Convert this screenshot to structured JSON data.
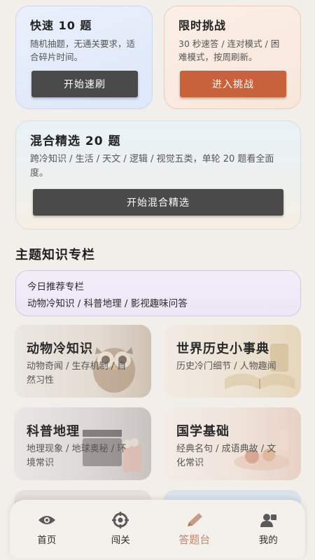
{
  "quick": {
    "title": "快速 10 题",
    "desc": "随机抽题，无通关要求，适合碎片时间。",
    "button": "开始速刷"
  },
  "timed": {
    "title": "限时挑战",
    "desc": "30 秒速答 / 连对模式 / 困难模式，按周刷新。",
    "button": "进入挑战"
  },
  "mixed": {
    "title": "混合精选 20 题",
    "desc": "跨冷知识 / 生活 / 天文 / 逻辑 / 视觉五类，单轮 20 题看全面度。",
    "button": "开始混合精选"
  },
  "section_title": "主题知识专栏",
  "recommend": {
    "label": "今日推荐专栏",
    "topics": "动物冷知识 / 科普地理 / 影视趣味问答"
  },
  "topics": [
    {
      "title": "动物冷知识",
      "desc": "动物奇闻 / 生存机制 / 自然习性"
    },
    {
      "title": "世界历史小事典",
      "desc": "历史冷门细节 / 人物趣闻"
    },
    {
      "title": "科普地理",
      "desc": "地理现象 / 地球奥秘 / 环境常识"
    },
    {
      "title": "国学基础",
      "desc": "经典名句 / 成语典故 / 文化常识"
    }
  ],
  "tabs": [
    {
      "label": "首页",
      "icon": "eye-icon"
    },
    {
      "label": "闯关",
      "icon": "target-icon"
    },
    {
      "label": "答题台",
      "icon": "pencil-icon",
      "active": true
    },
    {
      "label": "我的",
      "icon": "user-icon"
    }
  ],
  "colors": {
    "accent": "#c8623c",
    "active_tab": "#b98a74",
    "dark_button": "#4a4a4a"
  }
}
